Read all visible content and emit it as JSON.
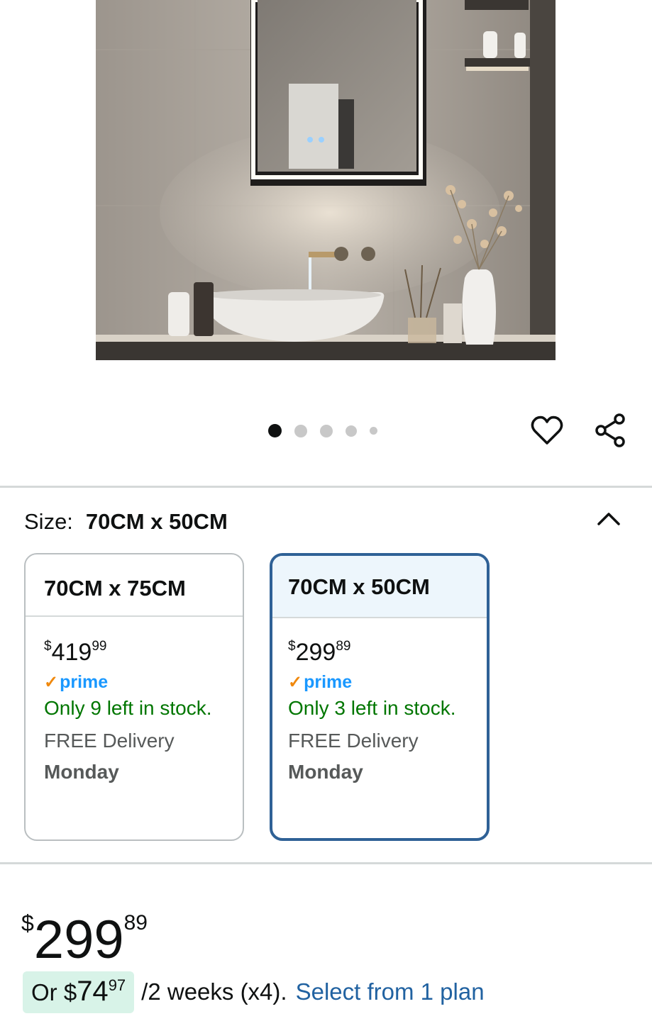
{
  "product": {
    "image_alt": "LED bathroom mirror cabinet",
    "carousel": {
      "count": 5,
      "active_index": 0
    },
    "icons": {
      "favorite": "heart-icon",
      "share": "share-icon",
      "collapse": "chevron-up-icon"
    }
  },
  "size": {
    "label": "Size:",
    "selected": "70CM x 50CM"
  },
  "variants": [
    {
      "name": "70CM x 75CM",
      "currency": "$",
      "price_whole": "419",
      "price_cents": "99",
      "prime": "prime",
      "stock": "Only 9 left in stock.",
      "delivery": "FREE Delivery",
      "delivery_day": "Monday",
      "selected": false
    },
    {
      "name": "70CM x 50CM",
      "currency": "$",
      "price_whole": "299",
      "price_cents": "89",
      "prime": "prime",
      "stock": "Only 3 left in stock.",
      "delivery": "FREE Delivery",
      "delivery_day": "Monday",
      "selected": true
    }
  ],
  "price": {
    "currency": "$",
    "whole": "299",
    "cents": "89"
  },
  "installment": {
    "prefix": "Or $",
    "amount_whole": "74",
    "amount_cents": "97",
    "terms": "/2 weeks (x4).",
    "link": "Select from 1 plan"
  },
  "colors": {
    "selected_border": "#2f6196",
    "stock_green": "#007600",
    "prime_blue": "#1a98ff",
    "link_blue": "#2162a1",
    "installment_highlight": "#d8f3e8"
  }
}
